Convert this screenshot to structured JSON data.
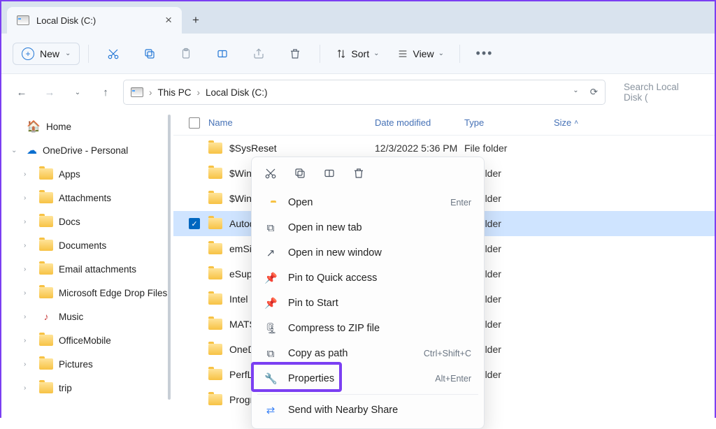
{
  "tab": {
    "title": "Local Disk (C:)"
  },
  "toolbar": {
    "new": "New",
    "sort": "Sort",
    "view": "View"
  },
  "breadcrumb": {
    "root": "This PC",
    "current": "Local Disk (C:)"
  },
  "search": {
    "placeholder": "Search Local Disk ("
  },
  "sidebar": {
    "home": "Home",
    "onedrive": "OneDrive - Personal",
    "items": [
      {
        "label": "Apps"
      },
      {
        "label": "Attachments"
      },
      {
        "label": "Docs"
      },
      {
        "label": "Documents"
      },
      {
        "label": "Email attachments"
      },
      {
        "label": "Microsoft Edge Drop Files"
      },
      {
        "label": "Music"
      },
      {
        "label": "OfficeMobile"
      },
      {
        "label": "Pictures"
      },
      {
        "label": "trip"
      }
    ]
  },
  "columns": {
    "name": "Name",
    "date": "Date modified",
    "type": "Type",
    "size": "Size"
  },
  "rows": [
    {
      "name": "$SysReset",
      "date": "12/3/2022 5:36 PM",
      "type": "File folder",
      "selected": false
    },
    {
      "name": "$Windo",
      "date": "",
      "type": "ile folder",
      "selected": false
    },
    {
      "name": "$WinRE",
      "date": "",
      "type": "ile folder",
      "selected": false
    },
    {
      "name": "Autode",
      "date": "",
      "type": "ile folder",
      "selected": true
    },
    {
      "name": "emSign",
      "date": "",
      "type": "ile folder",
      "selected": false
    },
    {
      "name": "eSuppo",
      "date": "",
      "type": "ile folder",
      "selected": false
    },
    {
      "name": "Intel",
      "date": "",
      "type": "ile folder",
      "selected": false
    },
    {
      "name": "MATS",
      "date": "",
      "type": "ile folder",
      "selected": false
    },
    {
      "name": "OneDri",
      "date": "",
      "type": "ile folder",
      "selected": false
    },
    {
      "name": "PerfLog",
      "date": "",
      "type": "ile folder",
      "selected": false
    },
    {
      "name": "Progran",
      "date": "",
      "type": "",
      "selected": false
    }
  ],
  "ctx": {
    "open": "Open",
    "open_kb": "Enter",
    "newtab": "Open in new tab",
    "newwin": "Open in new window",
    "pinqa": "Pin to Quick access",
    "pinstart": "Pin to Start",
    "zip": "Compress to ZIP file",
    "copypath": "Copy as path",
    "copypath_kb": "Ctrl+Shift+C",
    "props": "Properties",
    "props_kb": "Alt+Enter",
    "nearby": "Send with Nearby Share"
  }
}
